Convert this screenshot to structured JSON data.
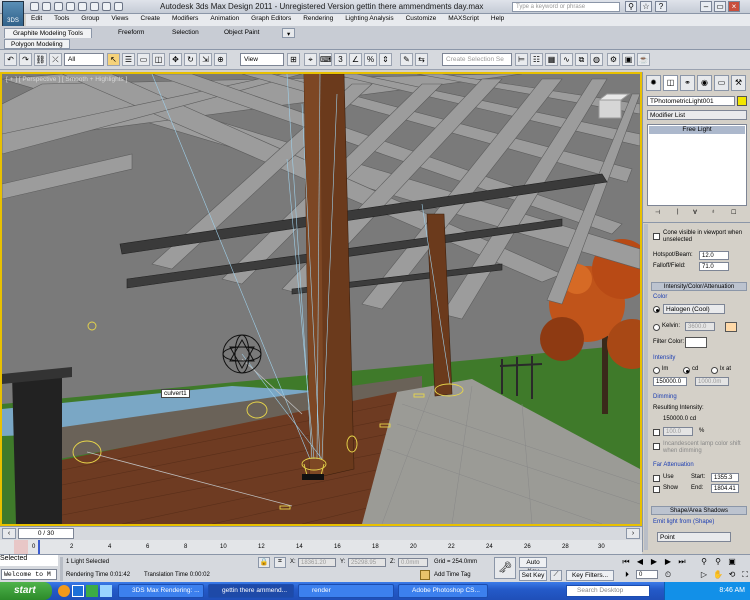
{
  "window": {
    "title": "Autodesk 3ds Max Design 2011  -  Unregistered Version    gettin there ammendments day.max",
    "logo_text": "3DS",
    "search_placeholder": "Type a keyword or phrase"
  },
  "menu": [
    "Edit",
    "Tools",
    "Group",
    "Views",
    "Create",
    "Modifiers",
    "Animation",
    "Graph Editors",
    "Rendering",
    "Lighting Analysis",
    "Customize",
    "MAXScript",
    "Help"
  ],
  "ribbon": {
    "tabs": [
      "Graphite Modeling Tools",
      "Freeform",
      "Selection",
      "Object Paint"
    ],
    "subtab": "Polygon Modeling"
  },
  "toolbar": {
    "filter_value": "All",
    "coord_value": "View",
    "selection_set_placeholder": "Create Selection Se"
  },
  "viewport": {
    "label": "[ + ] [ Perspective ] [ Smooth + Highlights ]",
    "object_tooltip": "culvert1"
  },
  "command_panel": {
    "object_name": "TPhotometricLight001",
    "modifier_list": "Modifier List",
    "stack_item": "Free Light",
    "cone_label": "Cone visible in viewport when unselected",
    "hotspot_label": "Hotspot/Beam:",
    "hotspot_value": "12.0",
    "falloff_label": "Falloff/Field:",
    "falloff_value": "71.0",
    "rollout_intensity": "Intensity/Color/Attenuation",
    "color_group": "Color",
    "color_preset": "Halogen (Cool)",
    "kelvin_label": "Kelvin:",
    "kelvin_value": "3600.0",
    "filter_color_label": "Filter Color:",
    "intensity_group": "Intensity",
    "unit_lm": "lm",
    "unit_cd": "cd",
    "unit_lx": "lx at",
    "intensity_value": "150000.0",
    "lx_distance": "1000.0m",
    "dimming_group": "Dimming",
    "resulting_label": "Resulting Intensity:",
    "resulting_value": "150000.0 cd",
    "dim_percent": "100.0",
    "dim_percent_unit": "%",
    "incandescent_label": "Incandescent lamp color shift when dimming",
    "far_atten_group": "Far Attenuation",
    "use_label": "Use",
    "show_label": "Show",
    "start_label": "Start:",
    "start_value": "1355.3",
    "end_label": "End:",
    "end_value": "1804.41",
    "rollout_shape": "Shape/Area Shadows",
    "emit_group": "Emit light from (Shape)",
    "emit_value": "Point"
  },
  "timeline": {
    "frame_display": "0 / 30",
    "ticks": [
      "0",
      "2",
      "4",
      "6",
      "8",
      "10",
      "12",
      "14",
      "16",
      "18",
      "20",
      "22",
      "24",
      "26",
      "28",
      "30"
    ]
  },
  "status": {
    "maxscript_listener": "Welcome to M",
    "selection_info": "1 Light Selected",
    "rendering_time": "Rendering Time  0:01:42",
    "translation_time": "Translation Time  0:00:02",
    "x_label": "X:",
    "x_value": "18361.20",
    "y_label": "Y:",
    "y_value": "25298.95",
    "z_label": "Z:",
    "z_value": "0.0mm",
    "grid": "Grid = 254.0mm",
    "add_time_tag": "Add Time Tag",
    "auto_key": "Auto Key",
    "set_key": "Set Key",
    "key_mode": "Selected",
    "key_filters": "Key Filters...",
    "frame_value": "0"
  },
  "taskbar": {
    "start": "start",
    "tasks": [
      "3DS Max Rendering: ...",
      "gettin there ammend...",
      "render",
      "Adobe Photoshop CS...",
      "Search Desktop"
    ],
    "clock": "8:46 AM"
  },
  "colors": {
    "viewport_border": "#e8c000",
    "filter_swatch": "#ffffff",
    "kelvin_swatch": "#ffd9a8"
  }
}
